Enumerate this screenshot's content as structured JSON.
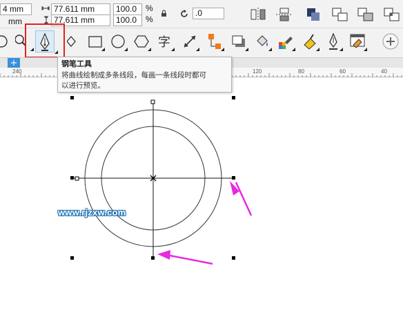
{
  "property_bar": {
    "x_partial": "4 mm",
    "y_partial": "mm",
    "width_value": "77.611 mm",
    "height_value": "77.611 mm",
    "scale_w": "100.0",
    "scale_h": "100.0",
    "percent": "%",
    "rotation_value": ".0"
  },
  "ruler": {
    "labels": [
      "240",
      "120",
      "80",
      "60",
      "40"
    ]
  },
  "tooltip": {
    "title": "钢笔工具",
    "description_line1": "将曲线绘制成多条线段，每画一条线段时都可",
    "description_line2": "以进行预览。"
  },
  "tools": [
    "shape-tool",
    "pen-tool",
    "rectangle-tool",
    "ellipse-tool",
    "polygon-tool",
    "text-tool",
    "dimension-tool",
    "connector-tool",
    "drop-shadow-tool",
    "fill-tool",
    "eyedropper-tool",
    "smart-fill-tool",
    "outline-pen-tool",
    "transparency-tool",
    "add-tool"
  ],
  "tab": {
    "add_label": "+"
  },
  "watermark": {
    "text": "www.rjzxw.com"
  },
  "colors": {
    "highlight": "#e0211f",
    "arrow": "#e829e0",
    "tab_blue": "#3a8fd8",
    "watermark_outline": "#1b6fb0"
  }
}
